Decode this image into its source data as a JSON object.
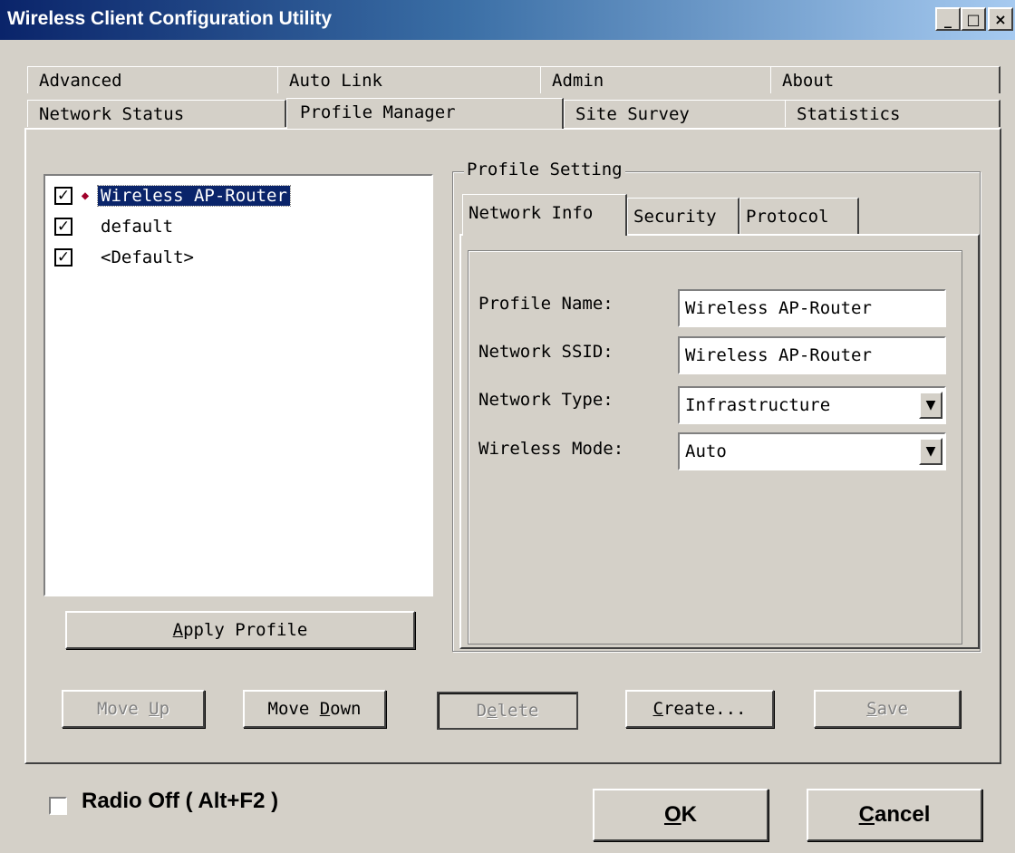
{
  "window": {
    "title": "Wireless Client Configuration Utility",
    "controls": {
      "minimize": "_",
      "maximize": "□",
      "close": "×"
    }
  },
  "tabs": {
    "row1": [
      "Advanced",
      "Auto Link",
      "Admin",
      "About"
    ],
    "row2": [
      "Network Status",
      "Profile Manager",
      "Site Survey",
      "Statistics"
    ],
    "active": "Profile Manager"
  },
  "profiles": {
    "items": [
      {
        "name": "Wireless AP-Router",
        "checked": true,
        "active": true
      },
      {
        "name": "default",
        "checked": true,
        "active": false
      },
      {
        "name": "<Default>",
        "checked": true,
        "active": false
      }
    ],
    "check_glyph": "✓",
    "active_glyph": "◆",
    "apply_button": {
      "pre": "",
      "accel": "A",
      "post": "pply Profile"
    }
  },
  "profile_setting": {
    "group_label": "Profile Setting",
    "tabs": [
      "Network Info",
      "Security",
      "Protocol"
    ],
    "active_tab": "Network Info",
    "fields": {
      "profile_name": {
        "label": "Profile Name:",
        "value": "Wireless AP-Router"
      },
      "ssid": {
        "label": "Network SSID:",
        "value": "Wireless AP-Router"
      },
      "network_type": {
        "label": "Network Type:",
        "value": "Infrastructure"
      },
      "wireless_mode": {
        "label": "Wireless Mode:",
        "value": "Auto"
      }
    },
    "dropdown_glyph": "▼"
  },
  "actions": {
    "move_up": {
      "pre": "Move ",
      "accel": "U",
      "post": "p",
      "enabled": false
    },
    "move_down": {
      "pre": "Move ",
      "accel": "D",
      "post": "own",
      "enabled": true
    },
    "delete": {
      "pre": "D",
      "accel": "e",
      "post": "lete",
      "enabled": false
    },
    "create": {
      "pre": "",
      "accel": "C",
      "post": "reate...",
      "enabled": true
    },
    "save": {
      "pre": "",
      "accel": "S",
      "post": "ave",
      "enabled": false
    }
  },
  "footer": {
    "radio_off": "Radio Off  ( Alt+F2 )",
    "radio_checked": false,
    "ok": {
      "accel": "O",
      "post": "K"
    },
    "cancel": {
      "accel": "C",
      "post": "ancel"
    }
  }
}
